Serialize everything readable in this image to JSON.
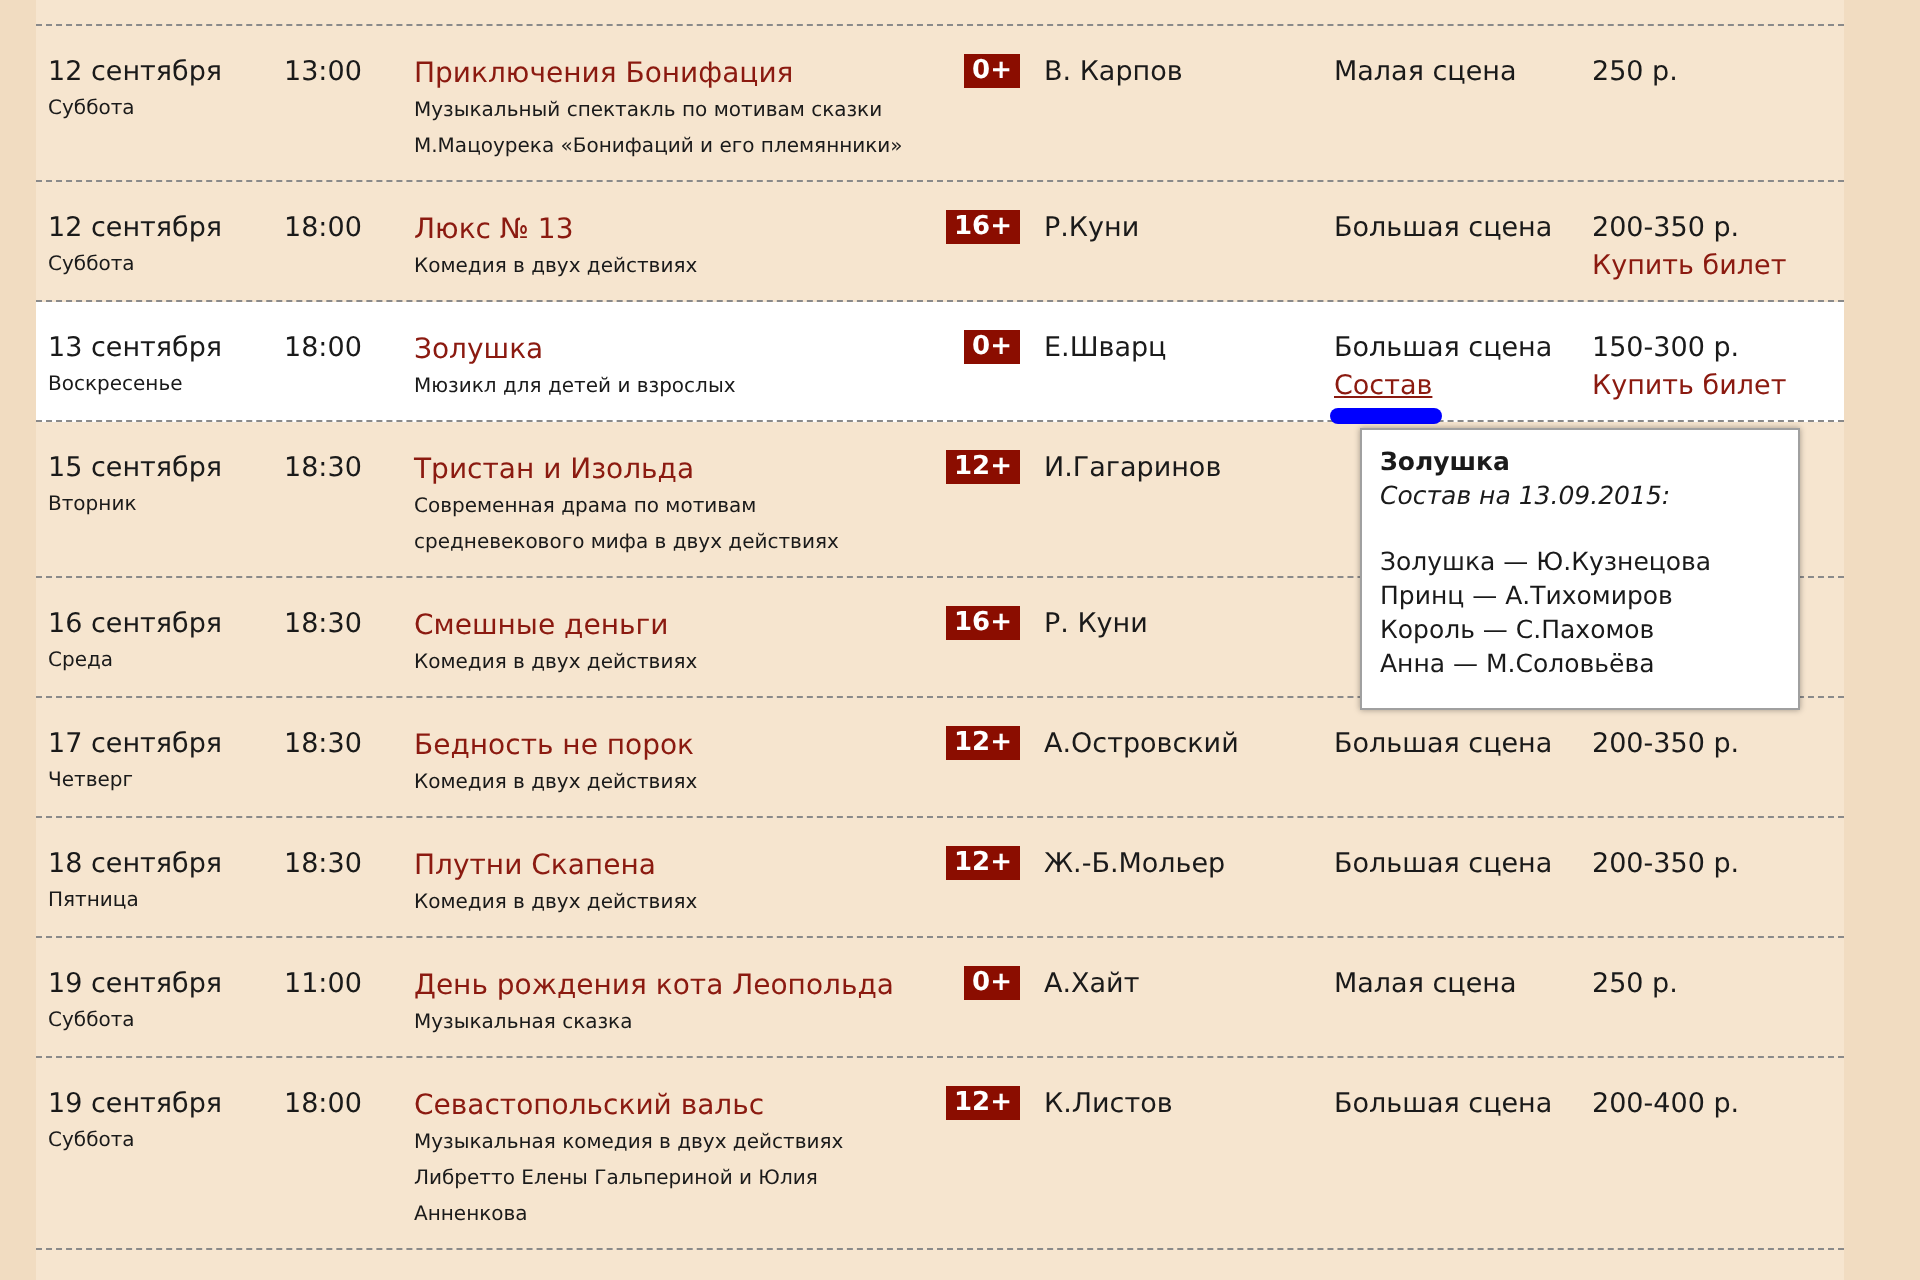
{
  "events": [
    {
      "date": "12 сентября",
      "weekday": "Суббота",
      "time": "13:00",
      "title": "Приключения Бонифация",
      "description": [
        "Музыкальный спектакль по мотивам сказки",
        "М.Мацоурека «Бонифаций и его племянники»"
      ],
      "age": "0+",
      "author": "В. Карпов",
      "stage": "Малая сцена",
      "price": "250 р.",
      "selected": false
    },
    {
      "date": "12 сентября",
      "weekday": "Суббота",
      "time": "18:00",
      "title": "Люкс № 13",
      "description": [
        "Комедия в двух действиях"
      ],
      "age": "16+",
      "author": "Р.Куни",
      "stage": "Большая сцена",
      "price": "200-350 р.",
      "buy_link": "Купить билет",
      "selected": false
    },
    {
      "date": "13 сентября",
      "weekday": "Воскресенье",
      "time": "18:00",
      "title": "Золушка",
      "description": [
        "Мюзикл для детей и взрослых"
      ],
      "age": "0+",
      "author": "Е.Шварц",
      "stage": "Большая сцена",
      "cast_link": "Состав",
      "price": "150-300 р.",
      "buy_link": "Купить билет",
      "selected": true,
      "cast_popup": {
        "title": "Золушка",
        "subtitle": "Состав на 13.09.2015:",
        "lines": [
          "Золушка — Ю.Кузнецова",
          "Принц — А.Тихомиров",
          "Король — С.Пахомов",
          "Анна — М.Соловьёва"
        ]
      }
    },
    {
      "date": "15 сентября",
      "weekday": "Вторник",
      "time": "18:30",
      "title": "Тристан и Изольда",
      "description": [
        "Современная драма по мотивам",
        "средневекового мифа в двух действиях"
      ],
      "age": "12+",
      "author": "И.Гагаринов",
      "selected": false
    },
    {
      "date": "16 сентября",
      "weekday": "Среда",
      "time": "18:30",
      "title": "Смешные деньги",
      "description": [
        "Комедия в двух действиях"
      ],
      "age": "16+",
      "author": "Р. Куни",
      "selected": false
    },
    {
      "date": "17 сентября",
      "weekday": "Четверг",
      "time": "18:30",
      "title": "Бедность не порок",
      "description": [
        "Комедия в двух действиях"
      ],
      "age": "12+",
      "author": "А.Островский",
      "stage": "Большая сцена",
      "price": "200-350 р.",
      "selected": false
    },
    {
      "date": "18 сентября",
      "weekday": "Пятница",
      "time": "18:30",
      "title": "Плутни Скапена",
      "description": [
        "Комедия в двух действиях"
      ],
      "age": "12+",
      "author": "Ж.-Б.Мольер",
      "stage": "Большая сцена",
      "price": "200-350 р.",
      "selected": false
    },
    {
      "date": "19 сентября",
      "weekday": "Суббота",
      "time": "11:00",
      "title": "День рождения кота Леопольда",
      "description": [
        "Музыкальная сказка"
      ],
      "age": "0+",
      "author": "А.Хайт",
      "stage": "Малая сцена",
      "price": "250 р.",
      "selected": false
    },
    {
      "date": "19 сентября",
      "weekday": "Суббота",
      "time": "18:00",
      "title": "Севастопольский вальс",
      "description": [
        "Музыкальная комедия в двух действиях",
        "Либретто Елены Гальпериной и Юлия",
        "Анненкова"
      ],
      "age": "12+",
      "author": "К.Листов",
      "stage": "Большая сцена",
      "price": "200-400 р.",
      "selected": false
    }
  ]
}
